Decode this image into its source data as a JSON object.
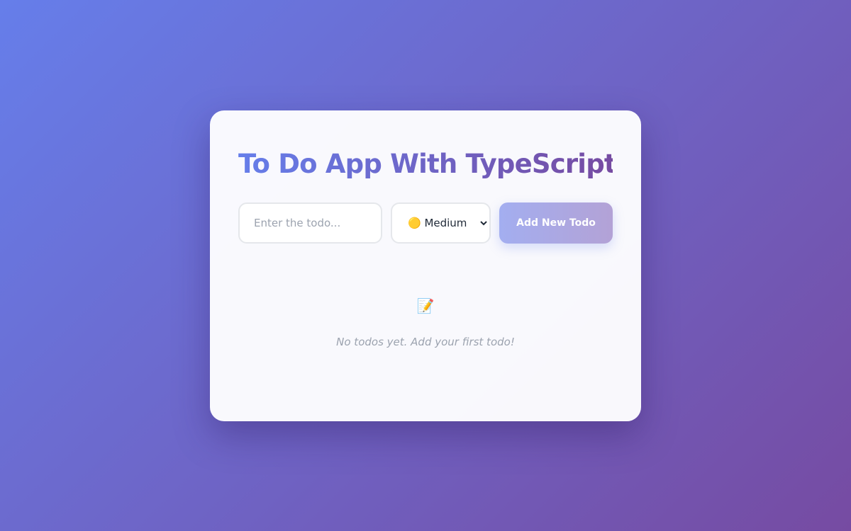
{
  "app": {
    "title": "To Do App With TypeScript"
  },
  "form": {
    "input_placeholder": "Enter the todo...",
    "input_value": "",
    "priority_selected": "🟡 Medium",
    "add_button_label": "Add New Todo"
  },
  "empty_state": {
    "icon": "📝",
    "icon_name": "memo-icon",
    "message": "No todos yet. Add your first todo!"
  },
  "colors": {
    "gradient_start": "#667eea",
    "gradient_end": "#764ba2"
  }
}
